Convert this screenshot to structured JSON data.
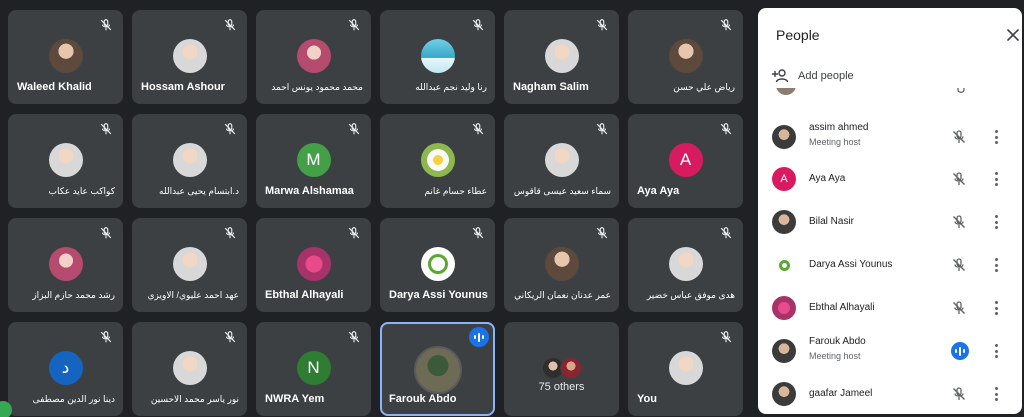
{
  "tiles": [
    {
      "name": "Waleed Khalid",
      "avatar": "photo",
      "muted": true
    },
    {
      "name": "Hossam Ashour",
      "avatar": "photo",
      "muted": true
    },
    {
      "name": "محمد محمود يونس احمد",
      "avatar": "photo",
      "muted": true,
      "rtl": true
    },
    {
      "name": "رنا وليد نجم عبدالله",
      "avatar": "photo",
      "muted": true,
      "rtl": true
    },
    {
      "name": "Nagham Salim",
      "avatar": "photo",
      "muted": true
    },
    {
      "name": "رياض علي حسن",
      "avatar": "photo",
      "muted": true,
      "rtl": true
    },
    {
      "name": "كواكب عايد عكاب",
      "avatar": "photo",
      "muted": true,
      "rtl": true
    },
    {
      "name": "د.ابتسام يحيى عبدالله",
      "avatar": "photo",
      "muted": true,
      "rtl": true
    },
    {
      "name": "Marwa Alshamaa",
      "avatar": "letter",
      "initial": "M",
      "color": "#43a047",
      "muted": true
    },
    {
      "name": "عطاء حسام غانم",
      "avatar": "photo",
      "muted": true,
      "rtl": true
    },
    {
      "name": "سماء سعيد عيسى قاقوس",
      "avatar": "photo",
      "muted": true,
      "rtl": true
    },
    {
      "name": "Aya Aya",
      "avatar": "letter",
      "initial": "A",
      "color": "#d81b60",
      "muted": true
    },
    {
      "name": "رشد محمد حازم البزاز",
      "avatar": "photo",
      "muted": true,
      "rtl": true
    },
    {
      "name": "عهد احمد عليوي/ الاويزي",
      "avatar": "photo",
      "muted": true,
      "rtl": true
    },
    {
      "name": "Ebthal Alhayali",
      "avatar": "photo",
      "muted": true
    },
    {
      "name": "Darya Assi Younus",
      "avatar": "photo",
      "muted": true
    },
    {
      "name": "عمر عدنان نعمان الريكاني",
      "avatar": "photo",
      "muted": true,
      "rtl": true
    },
    {
      "name": "هدى موفق عباس خضير",
      "avatar": "photo",
      "muted": true,
      "rtl": true
    },
    {
      "name": "دينا نور الدين مصطفى",
      "avatar": "letter",
      "initial": "د",
      "color": "#1565c0",
      "muted": true,
      "rtl": true
    },
    {
      "name": "نور ياسر محمد الاحسين",
      "avatar": "photo",
      "muted": true,
      "rtl": true
    },
    {
      "name": "NWRA Yem",
      "avatar": "letter",
      "initial": "N",
      "color": "#2e7d32",
      "muted": true
    },
    {
      "name": "Farouk Abdo",
      "avatar": "photo",
      "muted": false,
      "speaking": true
    },
    {
      "name": "",
      "avatar": "stack",
      "label": "75 others",
      "muted": false
    },
    {
      "name": "You",
      "avatar": "photo",
      "muted": true
    }
  ],
  "panel": {
    "title": "People",
    "add_people": "Add people",
    "participants": [
      {
        "name": "assim ahmed",
        "sub": "Meeting host",
        "avatar": "photo",
        "muted": true
      },
      {
        "name": "Aya Aya",
        "sub": "",
        "avatar": "letter",
        "initial": "A",
        "color": "#d81b60",
        "muted": true
      },
      {
        "name": "Bilal Nasir",
        "sub": "",
        "avatar": "photo",
        "muted": true
      },
      {
        "name": "Darya Assi Younus",
        "sub": "",
        "avatar": "logo",
        "muted": true
      },
      {
        "name": "Ebthal Alhayali",
        "sub": "",
        "avatar": "flower",
        "muted": true
      },
      {
        "name": "Farouk Abdo",
        "sub": "Meeting host",
        "avatar": "photo",
        "muted": false,
        "speaking": true
      },
      {
        "name": "gaafar Jameel",
        "sub": "",
        "avatar": "photo",
        "muted": true
      }
    ]
  },
  "colors": {
    "background": "#202124",
    "tile": "#3c4043",
    "accent": "#1a73e8",
    "speaking_outline": "#8ab4f8"
  },
  "icons": [
    "mic-off-icon",
    "audio-level-icon",
    "close-icon",
    "add-person-icon",
    "more-vert-icon"
  ]
}
